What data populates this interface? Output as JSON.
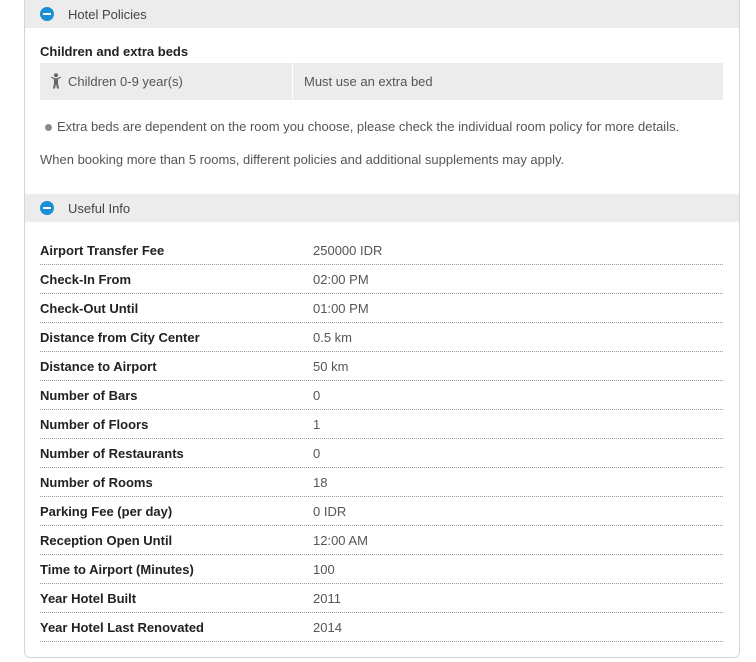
{
  "hotel_policies": {
    "title": "Hotel Policies",
    "subheading": "Children and extra beds",
    "child_policy": {
      "label": "Children 0-9 year(s)",
      "value": "Must use an extra bed"
    },
    "note_extra_beds": "Extra beds are dependent on the room you choose, please check the individual room policy for more details.",
    "note_booking": "When booking more than 5 rooms, different policies and additional supplements may apply."
  },
  "useful_info": {
    "title": "Useful Info",
    "rows": [
      {
        "label": "Airport Transfer Fee",
        "value": "250000 IDR"
      },
      {
        "label": "Check-In From",
        "value": "02:00 PM"
      },
      {
        "label": "Check-Out Until",
        "value": "01:00 PM"
      },
      {
        "label": "Distance from City Center",
        "value": "0.5 km"
      },
      {
        "label": "Distance to Airport",
        "value": "50 km"
      },
      {
        "label": "Number of Bars",
        "value": "0"
      },
      {
        "label": "Number of Floors",
        "value": "1"
      },
      {
        "label": "Number of Restaurants",
        "value": "0"
      },
      {
        "label": "Number of Rooms",
        "value": "18"
      },
      {
        "label": "Parking Fee (per day)",
        "value": "0 IDR"
      },
      {
        "label": "Reception Open Until",
        "value": "12:00 AM"
      },
      {
        "label": "Time to Airport (Minutes)",
        "value": "100"
      },
      {
        "label": "Year Hotel Built",
        "value": "2011"
      },
      {
        "label": "Year Hotel Last Renovated",
        "value": "2014"
      }
    ]
  },
  "colors": {
    "accent": "#1a8fd6",
    "header_bg": "#ececec",
    "border": "#d4d4d4"
  },
  "icons": {
    "toggle": "minus-circle-icon",
    "child": "child-icon",
    "bullet": "bullet-icon"
  }
}
